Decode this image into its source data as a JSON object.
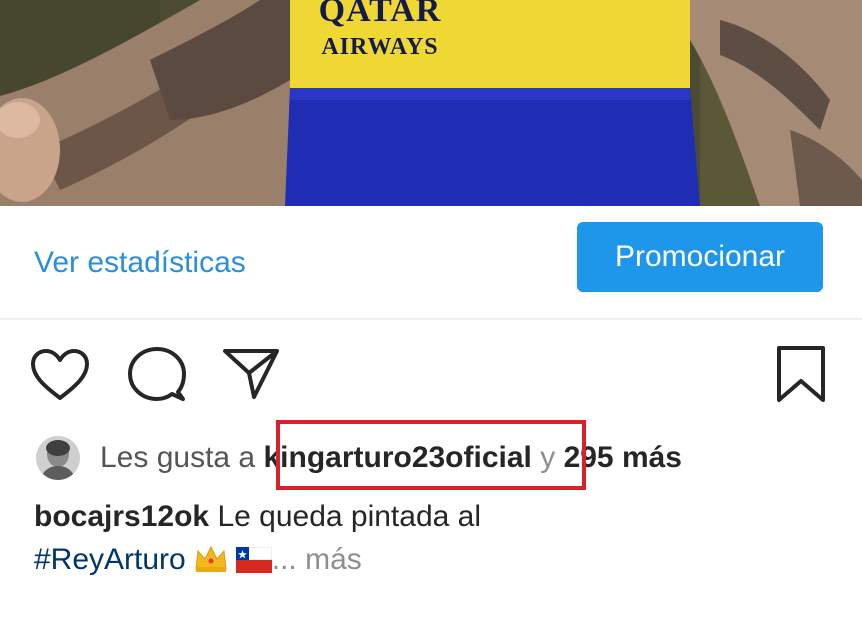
{
  "photo": {
    "sponsor_line1": "QATAR",
    "sponsor_line2": "AIRWAYS",
    "jersey_colors": {
      "yellow": "#f0d834",
      "blue": "#1f2db5"
    }
  },
  "insights": {
    "stats_link": "Ver estadísticas",
    "promote_button": "Promocionar"
  },
  "actions": {
    "like_icon": "heart-icon",
    "comment_icon": "comment-icon",
    "share_icon": "send-icon",
    "save_icon": "bookmark-icon"
  },
  "likes": {
    "prefix": "Les gusta a",
    "user": "kingarturo23oficial",
    "and": "y",
    "count": "295 más"
  },
  "caption": {
    "user": "bocajrs12ok",
    "text": "Le queda pintada al",
    "hashtag": "#ReyArturo",
    "emoji_icons": [
      "crown-emoji",
      "chile-flag-emoji"
    ],
    "ellipsis": "...",
    "more": "más"
  },
  "colors": {
    "link_blue": "#2b8fd6",
    "button_blue": "#1e96ea",
    "highlight_red": "#d8212b",
    "hashtag_blue": "#00376b",
    "text_dark": "#262626",
    "text_muted": "#8e8e8e"
  }
}
